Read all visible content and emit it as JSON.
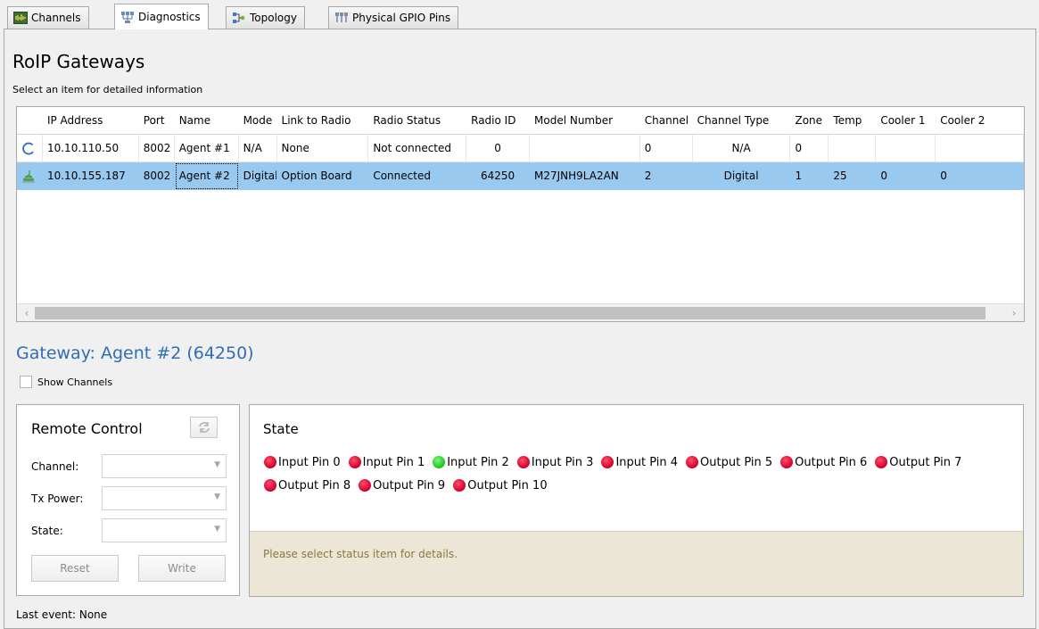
{
  "tabs": [
    {
      "label": "Channels",
      "icon": "waveform-icon"
    },
    {
      "label": "Diagnostics",
      "icon": "network-icon"
    },
    {
      "label": "Topology",
      "icon": "topology-icon"
    },
    {
      "label": "Physical GPIO Pins",
      "icon": "gpio-icon"
    }
  ],
  "active_tab": "Diagnostics",
  "section": {
    "title": "RoIP Gateways",
    "subtitle": "Select an item for detailed information"
  },
  "grid": {
    "columns": [
      "IP Address",
      "Port",
      "Name",
      "Mode",
      "Link to Radio",
      "Radio Status",
      "Radio ID",
      "Model Number",
      "Channel",
      "Channel Type",
      "Zone",
      "Temp",
      "Cooler 1",
      "Cooler 2"
    ],
    "rows": [
      {
        "status_icon": "connecting-spinner-icon",
        "ip": "10.10.110.50",
        "port": "8002",
        "name": "Agent #1",
        "mode": "N/A",
        "link": "None",
        "radio_status": "Not connected",
        "radio_id": "0",
        "model": "",
        "channel": "0",
        "channel_type": "N/A",
        "zone": "0",
        "temp": "",
        "cooler1": "",
        "cooler2": ""
      },
      {
        "status_icon": "connected-plug-icon",
        "ip": "10.10.155.187",
        "port": "8002",
        "name": "Agent #2",
        "mode": "Digital",
        "link": "Option Board",
        "radio_status": "Connected",
        "radio_id": "64250",
        "model": "M27JNH9LA2AN",
        "channel": "2",
        "channel_type": "Digital",
        "zone": "1",
        "temp": "25",
        "cooler1": "0",
        "cooler2": "0"
      }
    ]
  },
  "gateway": {
    "title": "Gateway: Agent #2 (64250)",
    "show_channels_label": "Show Channels",
    "show_channels_checked": false
  },
  "remote_control": {
    "title": "Remote Control",
    "channel_label": "Channel:",
    "tx_power_label": "Tx Power:",
    "state_label": "State:",
    "reset_label": "Reset",
    "write_label": "Write"
  },
  "state": {
    "title": "State",
    "pins": [
      {
        "label": "Input Pin 0",
        "status": "red"
      },
      {
        "label": "Input Pin 1",
        "status": "red"
      },
      {
        "label": "Input Pin 2",
        "status": "green"
      },
      {
        "label": "Input Pin 3",
        "status": "red"
      },
      {
        "label": "Input Pin 4",
        "status": "red"
      },
      {
        "label": "Output Pin 5",
        "status": "red"
      },
      {
        "label": "Output Pin 6",
        "status": "red"
      },
      {
        "label": "Output Pin 7",
        "status": "red"
      },
      {
        "label": "Output Pin 8",
        "status": "red"
      },
      {
        "label": "Output Pin 9",
        "status": "red"
      },
      {
        "label": "Output Pin 10",
        "status": "red"
      }
    ],
    "details_hint": "Please select status item for details."
  },
  "last_event": "Last event: None",
  "colors": {
    "accent_title": "#2f6eb4",
    "selected_row": "#99c9ef",
    "pin_red": "#d0002a",
    "pin_green": "#18c218",
    "details_bg": "#ebe6d6"
  }
}
